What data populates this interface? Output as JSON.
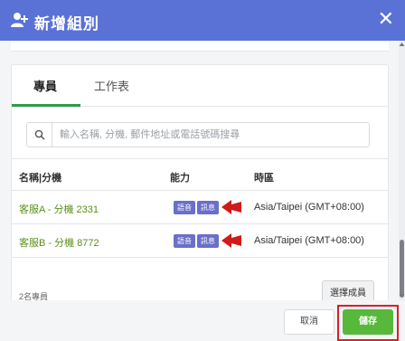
{
  "dialog": {
    "title": "新增組別",
    "close_symbol": "✕"
  },
  "tabs": [
    {
      "label": "專員",
      "active": true
    },
    {
      "label": "工作表",
      "active": false
    }
  ],
  "search": {
    "placeholder": "輸入名稱, 分機, 郵件地址或電話號碼搜尋",
    "value": ""
  },
  "table": {
    "headers": [
      "名稱|分機",
      "能力",
      "時區"
    ],
    "rows": [
      {
        "name": "客服A - 分機 2331",
        "capabilities": [
          "語音",
          "訊息"
        ],
        "timezone": "Asia/Taipei (GMT+08:00)"
      },
      {
        "name": "客服B - 分機 8772",
        "capabilities": [
          "語音",
          "訊息"
        ],
        "timezone": "Asia/Taipei (GMT+08:00)"
      }
    ]
  },
  "footer": {
    "count_text": "2名專員",
    "select_button": "選擇成員"
  },
  "actions": {
    "cancel": "取消",
    "save": "儲存"
  },
  "colors": {
    "header_bg": "#5a72d6",
    "accent_green": "#2e9a4b",
    "name_green": "#5a8f1a",
    "badge_purple": "#6a6fc8",
    "save_green": "#58b83c",
    "highlight_red": "#d8202a",
    "arrow_red": "#d11a1a"
  },
  "icons": {
    "header_icon": "add-user-icon",
    "search_icon": "search-icon",
    "row_marker": "red-arrow-icon"
  }
}
